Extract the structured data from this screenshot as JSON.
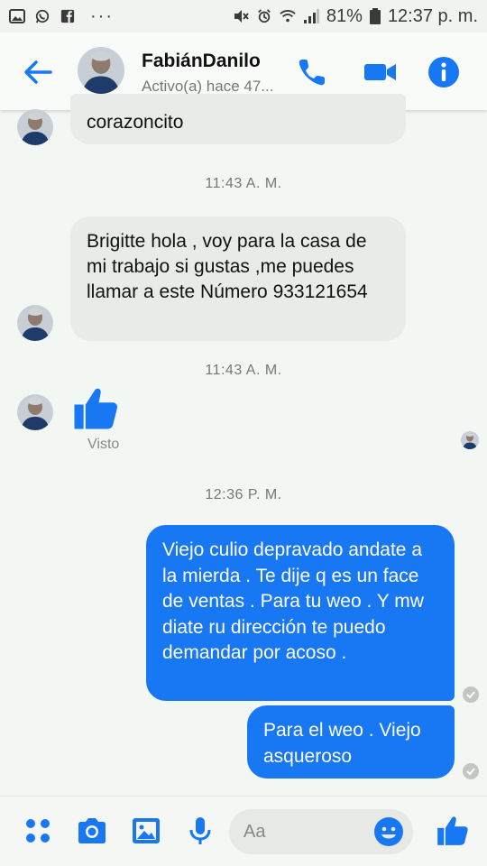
{
  "status_bar": {
    "battery": "81%",
    "time": "12:37 p. m."
  },
  "header": {
    "contact_name": "FabiánDanilo",
    "contact_status": "Activo(a) hace 47..."
  },
  "conversation": {
    "partial_message": "corazoncito",
    "time_1": "11:43 A. M.",
    "message_incoming": "Brigitte hola , voy para la casa de mi trabajo si gustas ,me puedes llamar a este Número 933121654",
    "time_2": "11:43 A. M.",
    "seen_label": "Visto",
    "time_3": "12:36 P. M.",
    "message_outgoing_1": "Viejo culio depravado andate a la mierda . Te dije q es un face de ventas . Para tu weo . Y mw diate ru dirección  te puedo demandar por acoso .",
    "message_outgoing_2": "Para el weo . Viejo asqueroso"
  },
  "composer": {
    "placeholder": "Aa"
  },
  "colors": {
    "accent": "#1877f2",
    "incoming_bubble": "#e8ebe8",
    "background": "#f3f7f3"
  },
  "icons": [
    "gallery-icon",
    "whatsapp-icon",
    "facebook-icon",
    "more-icon",
    "mute-icon",
    "alarm-icon",
    "wifi-icon",
    "signal-icon",
    "battery-icon",
    "back-arrow-icon",
    "phone-icon",
    "video-camera-icon",
    "info-icon",
    "thumbs-up-icon",
    "menu-dots-icon",
    "camera-icon",
    "image-icon",
    "microphone-icon",
    "emoji-icon"
  ]
}
